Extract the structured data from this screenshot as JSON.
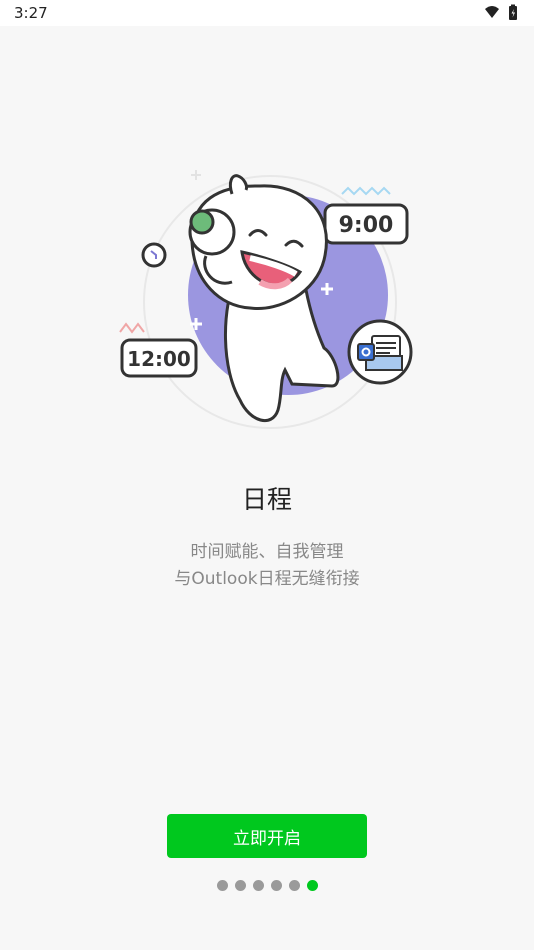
{
  "status_bar": {
    "time": "3:27",
    "icons": [
      "wifi-icon",
      "battery-charging-icon"
    ]
  },
  "illustration": {
    "time_badge_top": "9:00",
    "time_badge_left": "12:00",
    "icons": [
      "calendar-mascot-illustration",
      "outlook-mail-icon",
      "clock-icon"
    ]
  },
  "onboarding": {
    "title": "日程",
    "subtitle_line1": "时间赋能、自我管理",
    "subtitle_line2": "与Outlook日程无缝衔接",
    "start_button_label": "立即开启"
  },
  "pager": {
    "total": 6,
    "active_index": 5
  },
  "colors": {
    "accent": "#00c81e",
    "background": "#f7f7f7",
    "illustration_circle": "#9b96e0"
  }
}
